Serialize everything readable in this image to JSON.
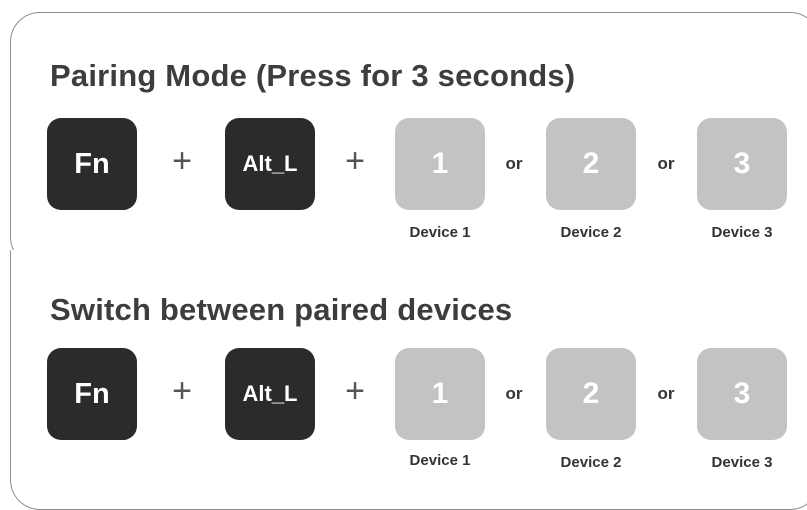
{
  "sections": [
    {
      "title": "Pairing Mode (Press for 3 seconds)",
      "keys": {
        "fn": "Fn",
        "alt": "Alt_L",
        "device_keys": [
          "1",
          "2",
          "3"
        ]
      },
      "plus": "+",
      "or": "or",
      "captions": [
        "Device 1",
        "Device 2",
        "Device 3"
      ]
    },
    {
      "title": "Switch between paired devices",
      "keys": {
        "fn": "Fn",
        "alt": "Alt_L",
        "device_keys": [
          "1",
          "2",
          "3"
        ]
      },
      "plus": "+",
      "or": "or",
      "captions": [
        "Device 1",
        "Device 2",
        "Device 3"
      ]
    }
  ],
  "colors": {
    "dark_key": "#2b2b2b",
    "light_key": "#c3c3c3",
    "title_text": "#3d3d3d",
    "panel_border": "#8f8f8f"
  }
}
